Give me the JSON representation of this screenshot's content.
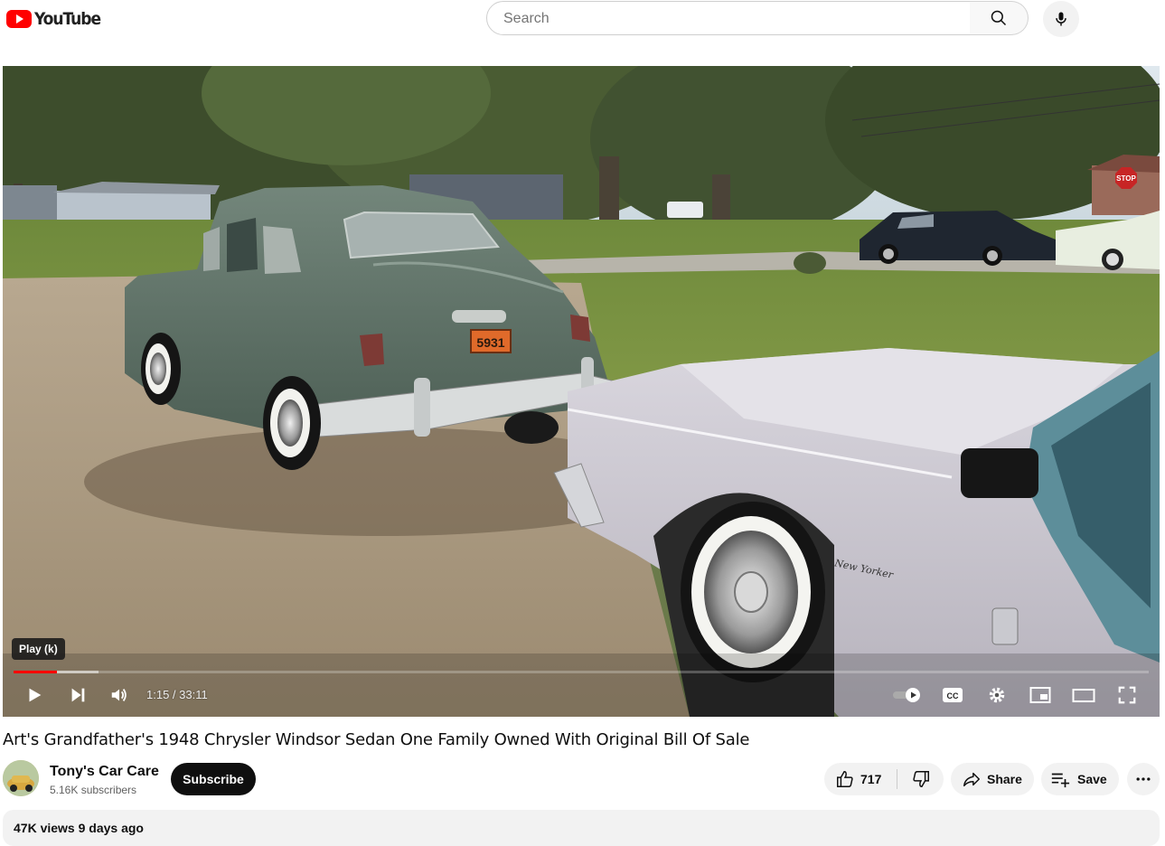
{
  "app": {
    "logo_text": "YouTube"
  },
  "search": {
    "placeholder": "Search"
  },
  "player": {
    "tooltip": "Play (k)",
    "current_time": "1:15",
    "duration": "33:11",
    "time_display": "1:15 / 33:11",
    "progress_fraction": 0.038,
    "buffered_fraction": 0.075,
    "scene": {
      "license_plate": "5931",
      "stop_sign_text": "STOP",
      "badge_script": "New Yorker"
    }
  },
  "video": {
    "title": "Art's Grandfather's 1948 Chrysler Windsor Sedan One Family Owned With Original Bill Of Sale"
  },
  "channel": {
    "name": "Tony's Car Care",
    "subscribers": "5.16K subscribers",
    "subscribe_label": "Subscribe"
  },
  "actions": {
    "like_count": "717",
    "share_label": "Share",
    "save_label": "Save"
  },
  "description": {
    "meta": "47K views  9 days ago"
  },
  "colors": {
    "brand_red": "#ff0000",
    "subscribe_bg": "#0f0f0f",
    "pill_bg": "#f2f2f2"
  },
  "icons": [
    "youtube-logo-icon",
    "search-icon",
    "mic-icon",
    "play-icon",
    "next-icon",
    "volume-icon",
    "autoplay-toggle-icon",
    "captions-icon",
    "settings-gear-icon",
    "miniplayer-icon",
    "theater-mode-icon",
    "fullscreen-icon",
    "thumbs-up-icon",
    "thumbs-down-icon",
    "share-arrow-icon",
    "save-playlist-icon",
    "more-dots-icon"
  ]
}
